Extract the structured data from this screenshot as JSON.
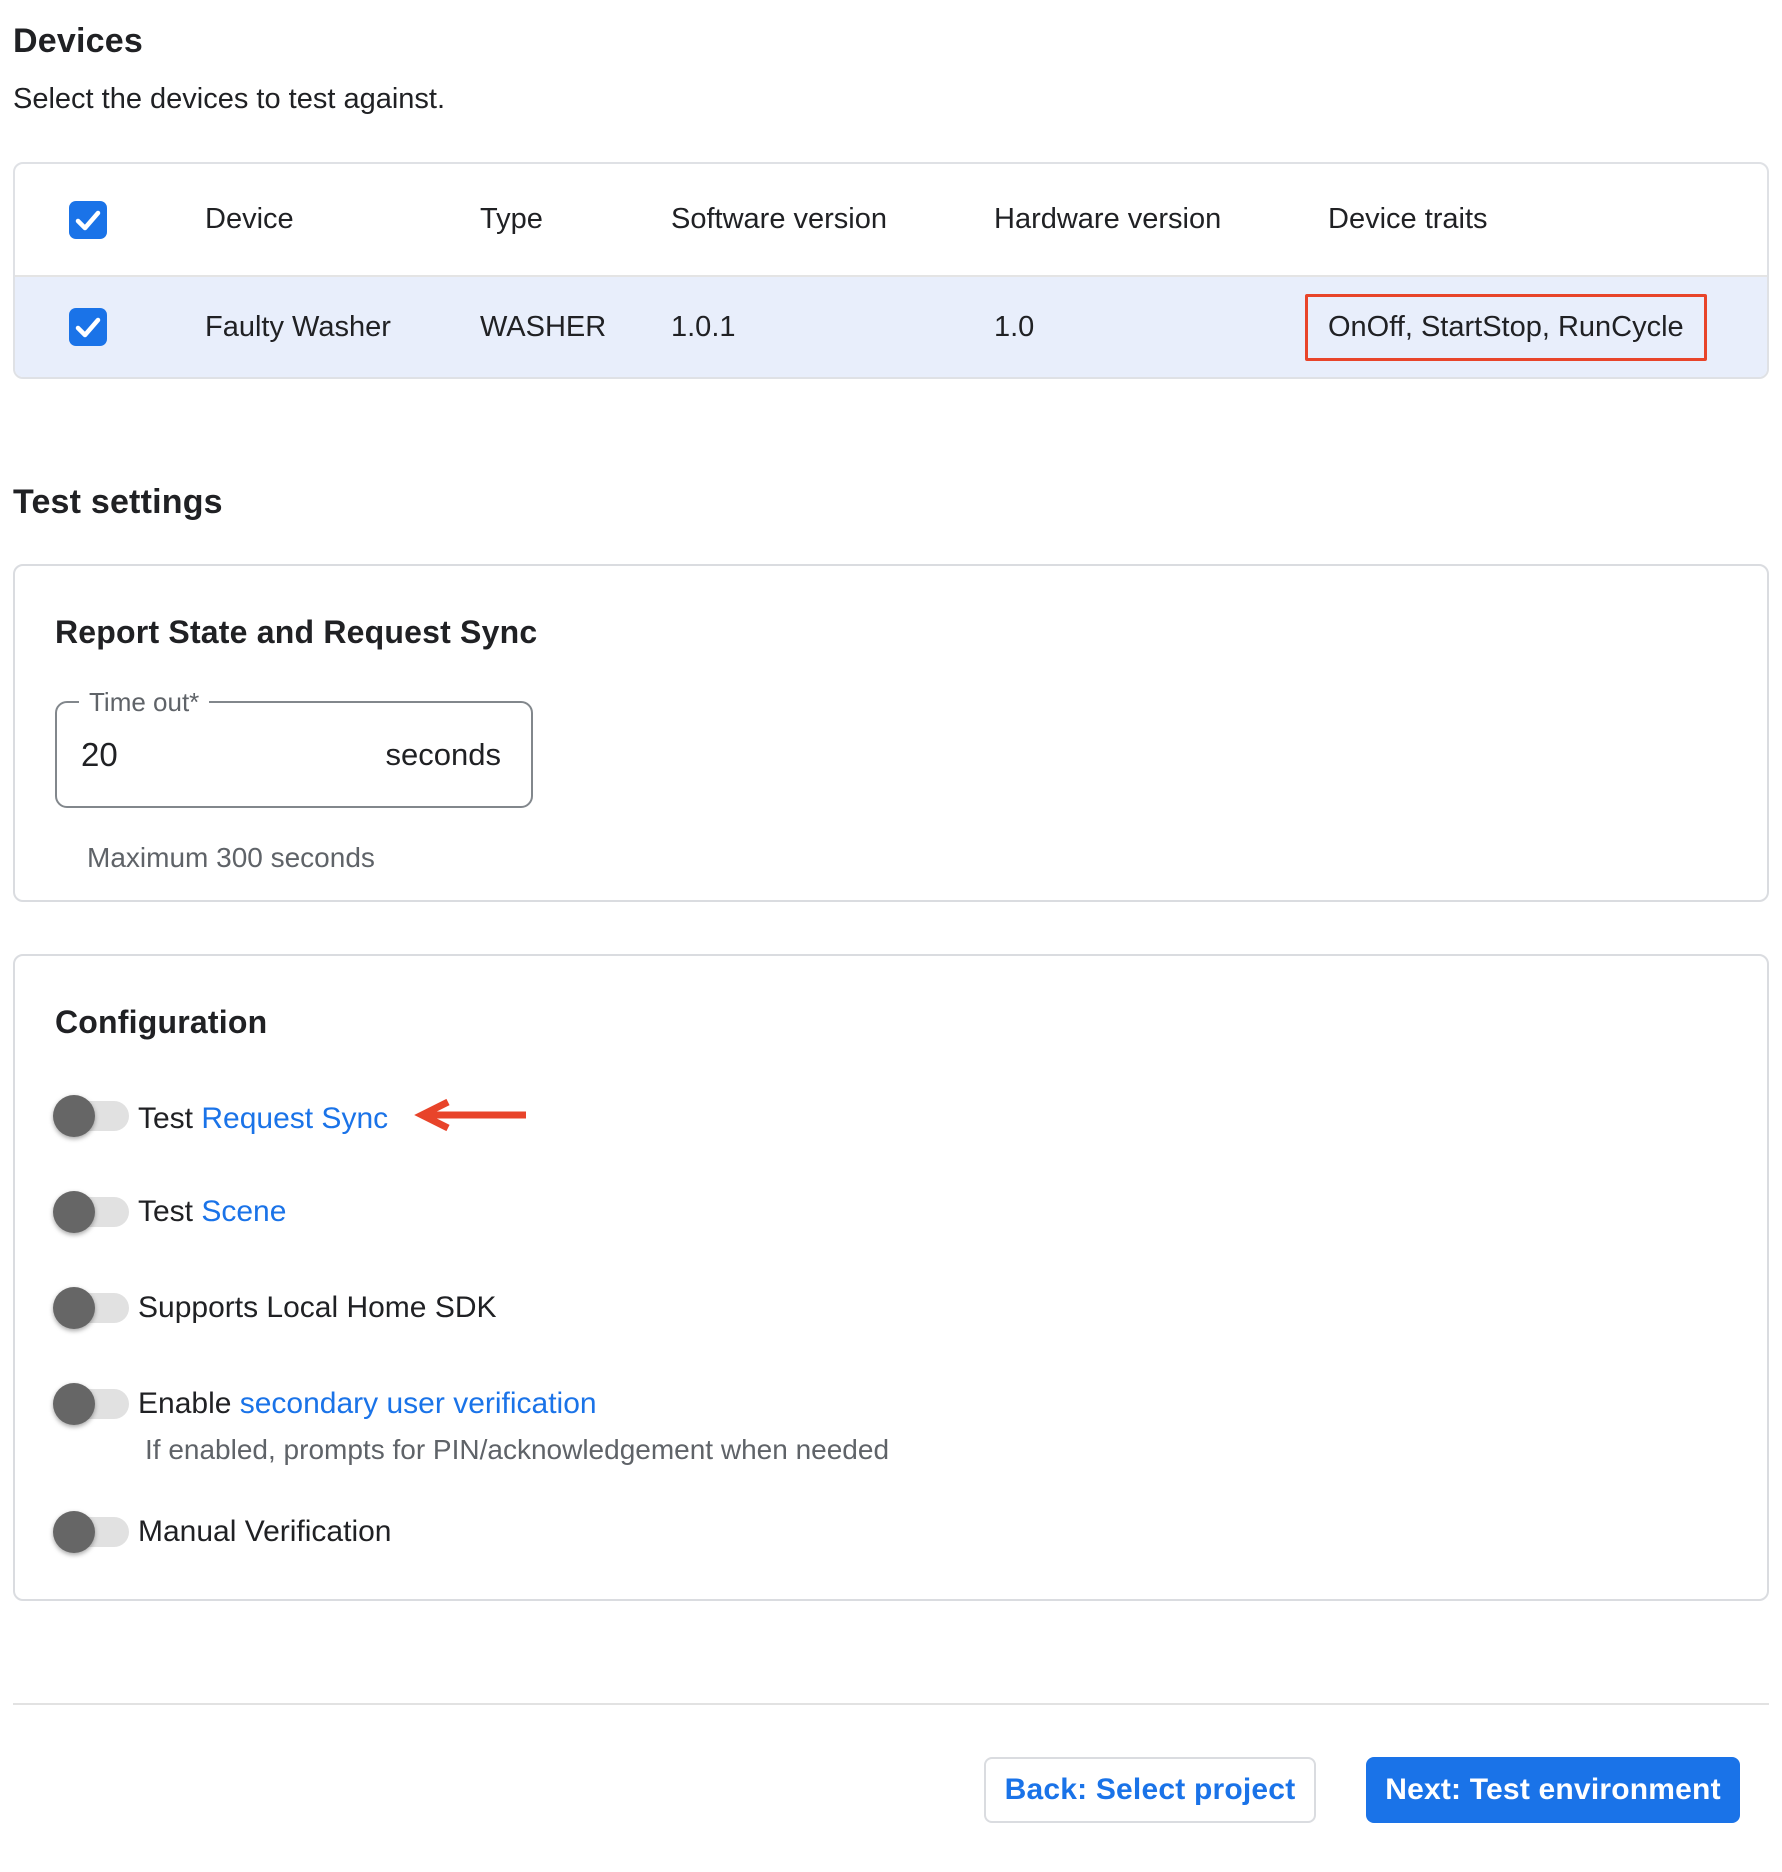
{
  "page": {
    "title": "Devices",
    "subtitle": "Select the devices to test against."
  },
  "device_table": {
    "columns": [
      "Device",
      "Type",
      "Software version",
      "Hardware version",
      "Device traits"
    ],
    "select_all_checked": true,
    "rows": [
      {
        "checked": true,
        "device": "Faulty Washer",
        "type": "WASHER",
        "software_version": "1.0.1",
        "hardware_version": "1.0",
        "device_traits": "OnOff, StartStop, RunCycle",
        "traits_highlighted": true
      }
    ]
  },
  "test_settings": {
    "heading": "Test settings",
    "report_card": {
      "title": "Report State and Request Sync",
      "timeout_label": "Time out*",
      "timeout_value": "20",
      "timeout_unit": "seconds",
      "helper": "Maximum 300 seconds"
    },
    "config_card": {
      "title": "Configuration",
      "toggles": [
        {
          "prefix": "Test ",
          "link": "Request Sync",
          "state": "off",
          "annotation": "red-arrow-pointing-left"
        },
        {
          "prefix": "Test ",
          "link": "Scene",
          "state": "off"
        },
        {
          "prefix": "Supports Local Home SDK",
          "state": "off"
        },
        {
          "prefix": "Enable ",
          "link": "secondary user verification",
          "state": "off",
          "helper": "If enabled, prompts for PIN/acknowledgement when needed"
        },
        {
          "prefix": "Manual Verification",
          "state": "off"
        }
      ]
    }
  },
  "actions": {
    "back": "Back: Select project",
    "next": "Next: Test environment"
  },
  "colors": {
    "accent_blue": "#1a73e8",
    "row_highlight": "#e8eefb",
    "annotation_red": "#e8442a",
    "toggle_thumb": "#666666",
    "toggle_track": "#e1e1e1"
  }
}
